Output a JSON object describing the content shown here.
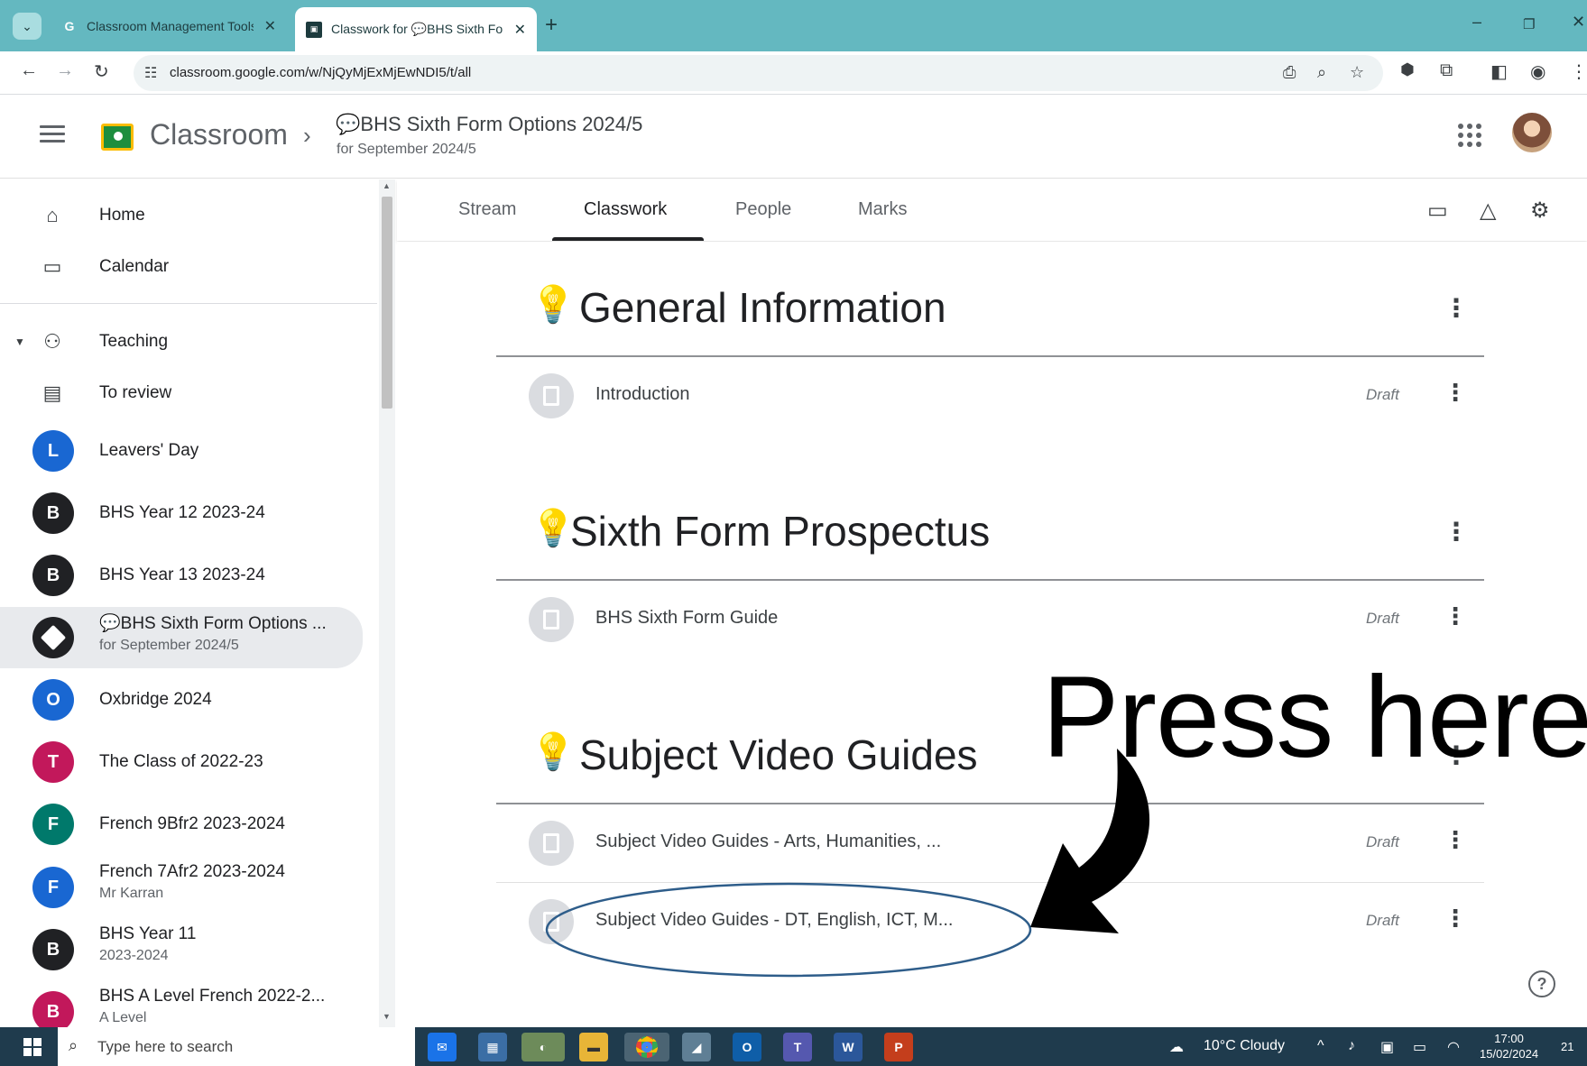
{
  "browser": {
    "tabs": [
      {
        "title": "Classroom Management Tools &",
        "favicon": "google-g-icon"
      },
      {
        "title": "Classwork for 💬BHS Sixth Form",
        "favicon": "classroom-icon"
      }
    ],
    "url": "classroom.google.com/w/NjQyMjExMjEwNDI5/t/all"
  },
  "header": {
    "app_name": "Classroom",
    "class_title": "💬BHS Sixth Form Options 2024/5",
    "class_subtitle": "for September 2024/5"
  },
  "sidebar": {
    "nav": [
      {
        "label": "Home",
        "icon": "home-icon"
      },
      {
        "label": "Calendar",
        "icon": "calendar-icon"
      }
    ],
    "teaching": {
      "label": "Teaching",
      "icon": "people-icon"
    },
    "to_review": {
      "label": "To review",
      "icon": "review-folder-icon"
    },
    "classes": [
      {
        "initial": "L",
        "name": "Leavers' Day",
        "sub": "",
        "color": "#1967d2"
      },
      {
        "initial": "B",
        "name": "BHS Year 12 2023-24",
        "sub": "",
        "color": "#202124"
      },
      {
        "initial": "B",
        "name": "BHS Year 13 2023-24",
        "sub": "",
        "color": "#202124"
      },
      {
        "initial": "?",
        "name": "💬BHS Sixth Form Options ...",
        "sub": "for September 2024/5",
        "color": "#202124"
      },
      {
        "initial": "O",
        "name": "Oxbridge 2024",
        "sub": "",
        "color": "#1967d2"
      },
      {
        "initial": "T",
        "name": "The Class of 2022-23",
        "sub": "",
        "color": "#c2185b"
      },
      {
        "initial": "F",
        "name": "French 9Bfr2 2023-2024",
        "sub": "",
        "color": "#00796b"
      },
      {
        "initial": "F",
        "name": "French 7Afr2 2023-2024",
        "sub": "Mr Karran",
        "color": "#1967d2"
      },
      {
        "initial": "B",
        "name": "BHS Year 11",
        "sub": "2023-2024",
        "color": "#202124"
      },
      {
        "initial": "B",
        "name": "BHS A Level French 2022-2...",
        "sub": "A Level",
        "color": "#c2185b"
      }
    ]
  },
  "class_tabs": [
    "Stream",
    "Classwork",
    "People",
    "Marks"
  ],
  "topics": [
    {
      "title": "General Information",
      "items": [
        {
          "name": "Introduction",
          "status": "Draft"
        }
      ]
    },
    {
      "title": "Sixth Form Prospectus",
      "items": [
        {
          "name": "BHS Sixth Form Guide",
          "status": "Draft"
        }
      ]
    },
    {
      "title": "Subject Video Guides",
      "items": [
        {
          "name": "Subject Video Guides - Arts, Humanities, ...",
          "status": "Draft"
        },
        {
          "name": "Subject Video Guides - DT, English, ICT, M...",
          "status": "Draft"
        }
      ]
    }
  ],
  "annotation": {
    "text": "Press here"
  },
  "taskbar": {
    "search_placeholder": "Type here to search",
    "weather": "10°C  Cloudy",
    "time": "17:00",
    "date": "15/02/2024",
    "notifications": "21"
  }
}
